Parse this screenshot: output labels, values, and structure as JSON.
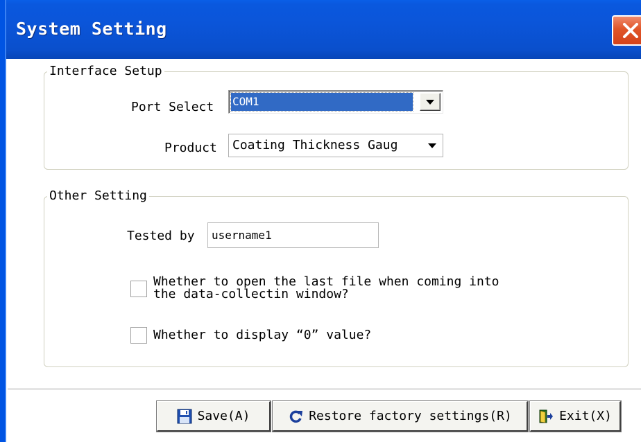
{
  "window": {
    "title": "System Setting",
    "close_icon": "close-icon"
  },
  "interface_setup": {
    "title": "Interface Setup",
    "port_label": "Port Select",
    "port_value": "COM1",
    "product_label": "Product",
    "product_value": "Coating Thickness Gaug"
  },
  "other_setting": {
    "title": "Other Setting",
    "tested_by_label": "Tested by",
    "tested_by_value": "username1",
    "open_last_file_line1": "Whether to open the last file when coming into",
    "open_last_file_line2": "the data-collectin window?",
    "open_last_file_checked": false,
    "display_zero_label": "Whether to display “0” value?",
    "display_zero_checked": false
  },
  "buttons": {
    "save": "Save(A)",
    "restore": "Restore factory settings(R)",
    "exit": "Exit(X)"
  },
  "colors": {
    "titlebar": "#0a55d9",
    "selection": "#316ac5",
    "close": "#e05528"
  }
}
